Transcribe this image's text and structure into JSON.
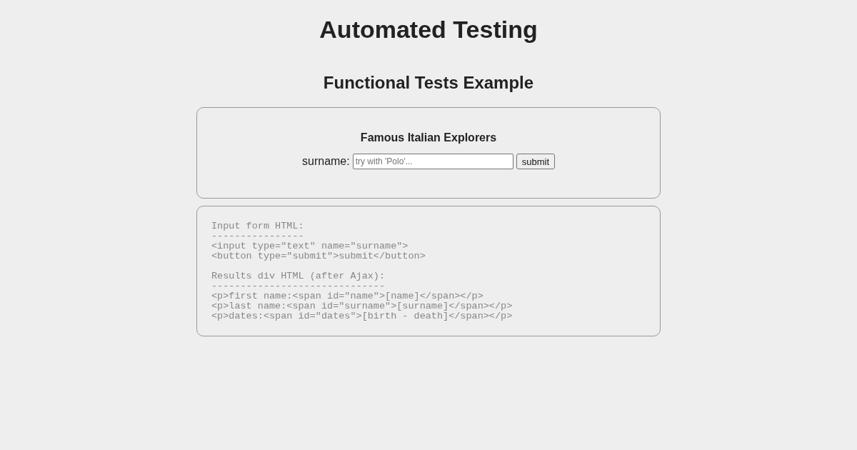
{
  "title": "Automated Testing",
  "subtitle": "Functional Tests Example",
  "form": {
    "heading": "Famous Italian Explorers",
    "label": "surname:",
    "placeholder": "try with 'Polo'...",
    "button": "submit"
  },
  "code_blocks": [
    {
      "lines": [
        "Input form HTML:",
        "----------------",
        "<input type=\"text\" name=\"surname\">",
        "<button type=\"submit\">submit</button>"
      ]
    },
    {
      "lines": [
        "Results div HTML (after Ajax):",
        "------------------------------",
        "<p>first name:<span id=\"name\">[name]</span></p>",
        "<p>last name:<span id=\"surname\">[surname]</span></p>",
        "<p>dates:<span id=\"dates\">[birth - death]</span></p>"
      ]
    }
  ]
}
